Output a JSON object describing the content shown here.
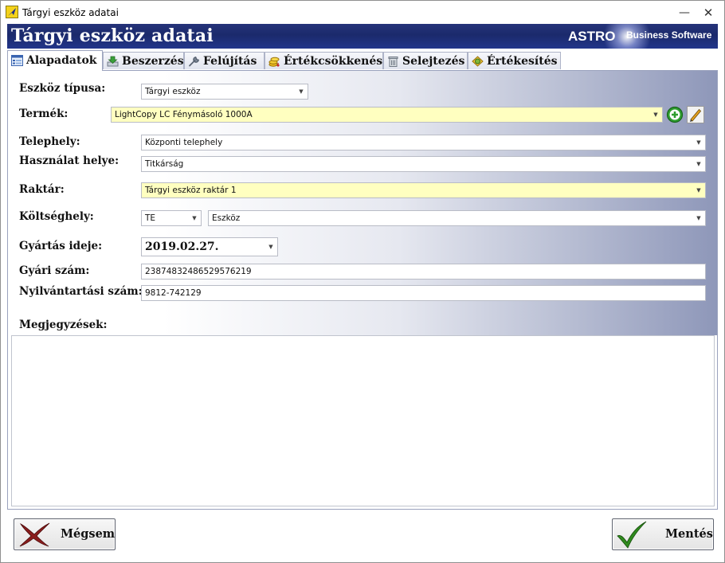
{
  "window": {
    "title": "Tárgyi eszköz adatai"
  },
  "banner": {
    "title": "Tárgyi eszköz adatai",
    "brand": "ASTRO",
    "brand_sub": "Business Software"
  },
  "tabs": [
    {
      "label": "Alapadatok",
      "icon": "form-icon"
    },
    {
      "label": "Beszerzés",
      "icon": "download-icon"
    },
    {
      "label": "Felújítás",
      "icon": "wrench-icon"
    },
    {
      "label": "Értékcsökkenés",
      "icon": "coins-icon"
    },
    {
      "label": "Selejtezés",
      "icon": "trash-icon"
    },
    {
      "label": "Értékesítés",
      "icon": "money-icon"
    }
  ],
  "form": {
    "eszkoz_tipusa": {
      "label": "Eszköz típusa:",
      "value": "Tárgyi eszköz"
    },
    "termek": {
      "label": "Termék:",
      "value": "LightCopy LC Fénymásoló 1000A"
    },
    "telephely": {
      "label": "Telephely:",
      "value": "Központi telephely"
    },
    "hasznalat_helye": {
      "label": "Használat helye:",
      "value": "Titkárság"
    },
    "raktar": {
      "label": "Raktár:",
      "value": "Tárgyi eszköz raktár 1"
    },
    "koltseghely": {
      "label": "Költséghely:",
      "code": "TE",
      "value": "Eszköz"
    },
    "gyartas_ideje": {
      "label": "Gyártás ideje:",
      "value": "2019.02.27."
    },
    "gyari_szam": {
      "label": "Gyári szám:",
      "value": "23874832486529576219"
    },
    "nyilvantartasi_szam": {
      "label": "Nyilvántartási szám:",
      "value": "9812-742129"
    },
    "megjegyzesek": {
      "label": "Megjegyzések:",
      "value": ""
    }
  },
  "buttons": {
    "cancel": "Mégsem",
    "save": "Mentés"
  },
  "colors": {
    "banner": "#1b2a6c",
    "highlight_field": "#ffffc0",
    "add_icon": "#2e9d2e",
    "cancel_icon": "#8a1d1d",
    "save_icon": "#2f8a1e"
  }
}
